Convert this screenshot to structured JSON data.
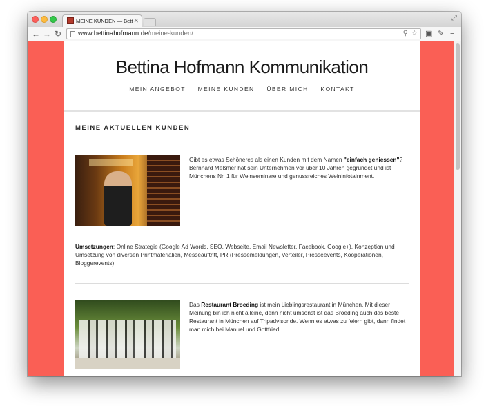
{
  "browser": {
    "tab_title": "MEINE KUNDEN — Bettina",
    "tab_close": "✕",
    "url_domain": "www.bettinahofmann.de",
    "url_path": "/meine-kunden/"
  },
  "site": {
    "title": "Bettina Hofmann Kommunikation",
    "nav": [
      "MEIN ANGEBOT",
      "MEINE KUNDEN",
      "ÜBER MICH",
      "KONTAKT"
    ]
  },
  "content": {
    "heading": "MEINE AKTUELLEN KUNDEN",
    "client1": {
      "intro_prefix": "Gibt es etwas Schöneres als einen Kunden mit dem Namen ",
      "intro_bold": "\"einfach geniessen\"",
      "intro_suffix": "?  Bernhard Meßmer hat sein Unternehmen vor über 10 Jahren gegründet und ist Münchens Nr. 1 für Weinseminare und genussreiches Weininfotainment.",
      "services_label": "Umsetzungen",
      "services_text": ": Online Strategie (Google Ad Words, SEO, Webseite, Email Newsletter, Facebook, Google+), Konzeption und Umsetzung von diversen Printmaterialien, Messeauftritt, PR (Pressemeldungen, Verteiler, Presseevents, Kooperationen, Bloggerevents)."
    },
    "client2": {
      "prefix": "Das ",
      "bold": "Restaurant Broeding",
      "text": " ist mein Lieblingsrestaurant in München. Mit dieser Meinung bin ich nicht alleine, denn nicht umsonst ist das Broeding auch das beste Restaurant in München auf Tripadvisor.de. Wenn es etwas zu feiern gibt, dann findet man mich bei Manuel und Gottfried!"
    }
  },
  "colors": {
    "background_accent": "#fa5f55"
  }
}
